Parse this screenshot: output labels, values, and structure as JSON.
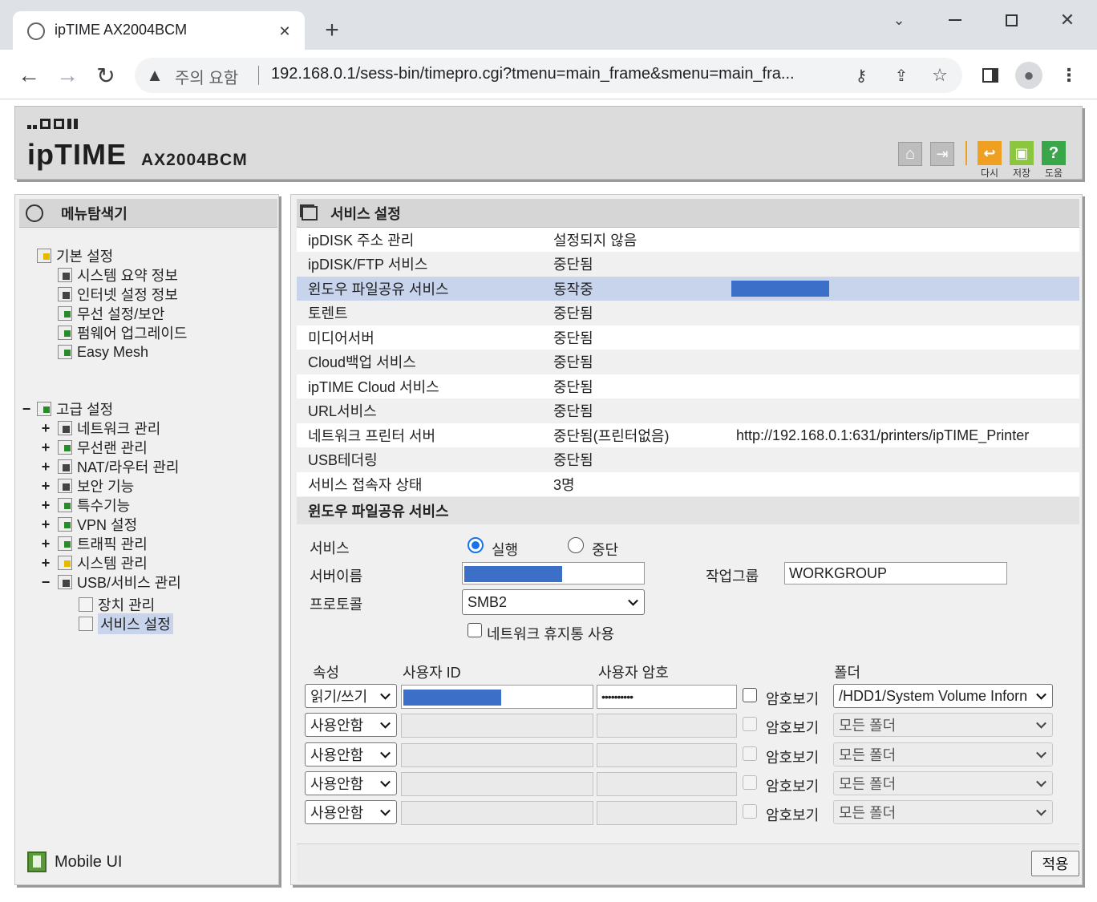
{
  "browser": {
    "tab_title": "ipTIME AX2004BCM",
    "security_label": "주의 요함",
    "url": "192.168.0.1/sess-bin/timepro.cgi?tmenu=main_frame&smenu=main_fra...",
    "new_tab": "+",
    "tab_close": "✕"
  },
  "header": {
    "brand": "ipTIME",
    "model": "AX2004BCM",
    "toolbar": [
      {
        "label": "다시",
        "color": "#f0a020",
        "icon": "refresh-icon"
      },
      {
        "label": "저장",
        "color": "#8cc63f",
        "icon": "save-icon"
      },
      {
        "label": "도움",
        "color": "#3aa64a",
        "icon": "help-icon"
      }
    ]
  },
  "sidebar": {
    "title": "메뉴탐색기",
    "basic": {
      "label": "기본 설정",
      "items": [
        "시스템 요약 정보",
        "인터넷 설정 정보",
        "무선 설정/보안",
        "펌웨어 업그레이드",
        "Easy Mesh"
      ]
    },
    "advanced": {
      "label": "고급 설정",
      "items": [
        "네트워크 관리",
        "무선랜 관리",
        "NAT/라우터 관리",
        "보안 기능",
        "특수기능",
        "VPN 설정",
        "트래픽 관리",
        "시스템 관리",
        "USB/서비스 관리"
      ],
      "sub_items": [
        "장치 관리",
        "서비스 설정"
      ]
    },
    "mobile_ui": "Mobile UI"
  },
  "main": {
    "title": "서비스 설정",
    "services": [
      {
        "name": "ipDISK 주소 관리",
        "status": "설정되지 않음",
        "extra": ""
      },
      {
        "name": "ipDISK/FTP 서비스",
        "status": "중단됨",
        "extra": ""
      },
      {
        "name": "윈도우 파일공유 서비스",
        "status": "동작중",
        "extra": ""
      },
      {
        "name": "토렌트",
        "status": "중단됨",
        "extra": ""
      },
      {
        "name": "미디어서버",
        "status": "중단됨",
        "extra": ""
      },
      {
        "name": "Cloud백업 서비스",
        "status": "중단됨",
        "extra": ""
      },
      {
        "name": "ipTIME Cloud 서비스",
        "status": "중단됨",
        "extra": ""
      },
      {
        "name": "URL서비스",
        "status": "중단됨",
        "extra": ""
      },
      {
        "name": "네트워크 프린터 서버",
        "status": "중단됨(프린터없음)",
        "extra": "http://192.168.0.1:631/printers/ipTIME_Printer"
      },
      {
        "name": "USB테더링",
        "status": "중단됨",
        "extra": ""
      },
      {
        "name": "서비스 접속자 상태",
        "status": "3명",
        "extra": ""
      }
    ],
    "smb": {
      "section_title": "윈도우 파일공유 서비스",
      "service_label": "서비스",
      "radio_run": "실행",
      "radio_stop": "중단",
      "server_name_label": "서버이름",
      "workgroup_label": "작업그룹",
      "workgroup_value": "WORKGROUP",
      "protocol_label": "프로토콜",
      "protocol_value": "SMB2",
      "recycle_label": "네트워크 휴지통 사용",
      "col_attr": "속성",
      "col_user": "사용자 ID",
      "col_pass": "사용자 암호",
      "col_folder": "폴더",
      "show_pw": "암호보기",
      "users": [
        {
          "attr": "읽기/쓰기",
          "password": "••••••••••",
          "folder": "/HDD1/System Volume Inforn"
        },
        {
          "attr": "사용안함",
          "password": "",
          "folder": "모든 폴더"
        },
        {
          "attr": "사용안함",
          "password": "",
          "folder": "모든 폴더"
        },
        {
          "attr": "사용안함",
          "password": "",
          "folder": "모든 폴더"
        },
        {
          "attr": "사용안함",
          "password": "",
          "folder": "모든 폴더"
        }
      ],
      "apply": "적용"
    }
  }
}
